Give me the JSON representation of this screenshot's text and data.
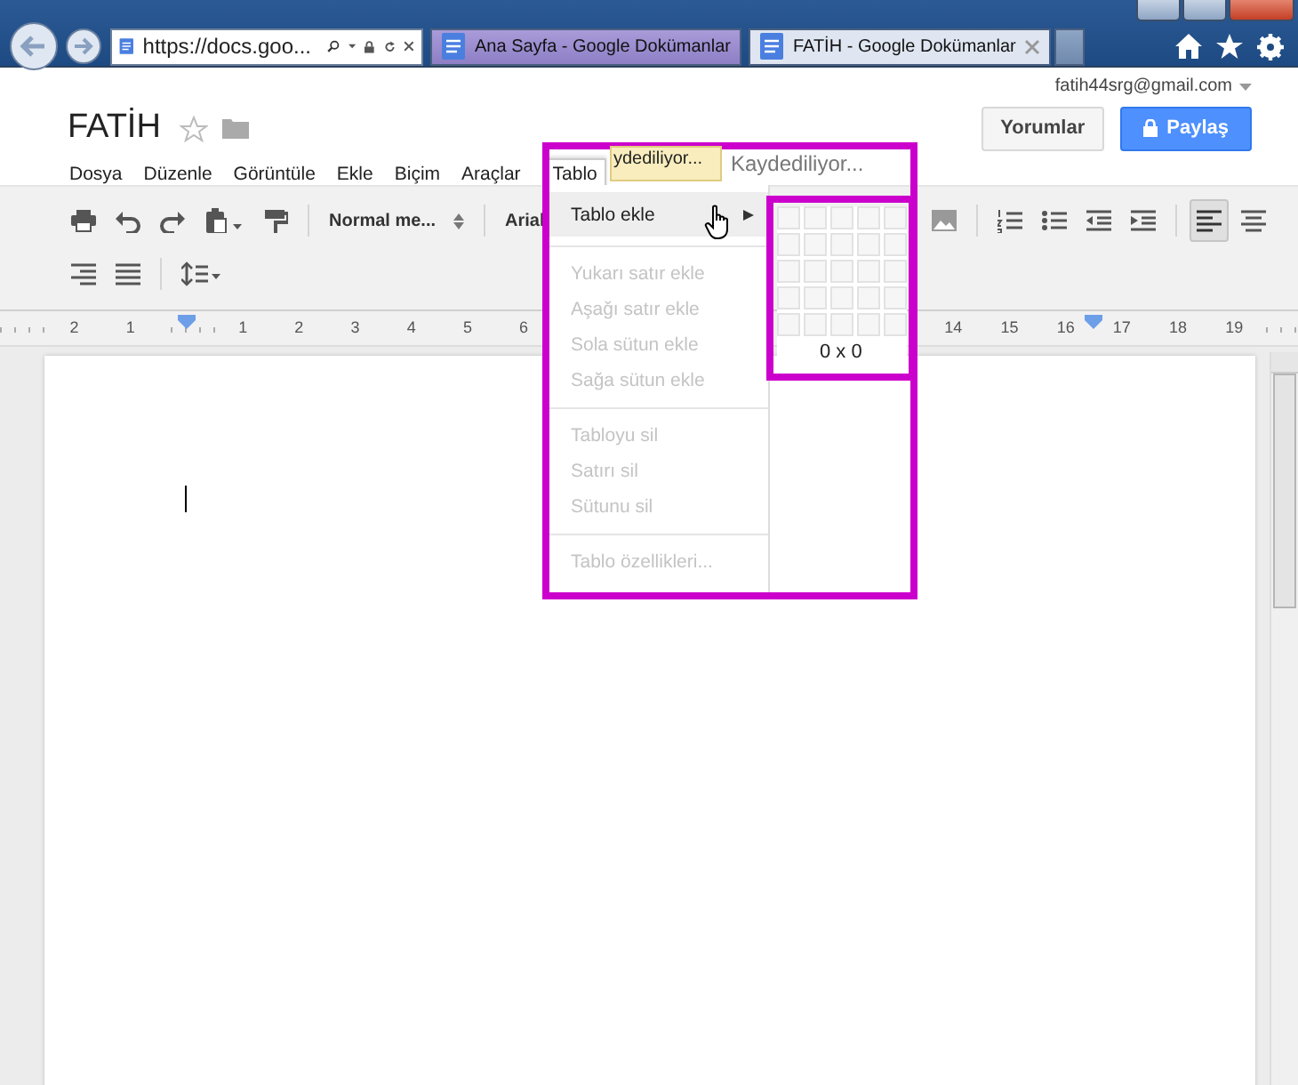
{
  "browser": {
    "address": "https://docs.goo...",
    "tabs": [
      {
        "title": "Ana Sayfa - Google Dokümanlar",
        "selected": false
      },
      {
        "title": "FATİH - Google Dokümanlar",
        "selected": true
      }
    ]
  },
  "document": {
    "title": "FATİH",
    "account": "fatih44srg@gmail.com",
    "buttons": [
      {
        "label": "Yorumlar",
        "kind": "plain"
      },
      {
        "label": "Paylaş",
        "kind": "share"
      }
    ],
    "menus": [
      {
        "label": "Dosya",
        "open": false
      },
      {
        "label": "Düzenle",
        "open": false
      },
      {
        "label": "Görüntüle",
        "open": false
      },
      {
        "label": "Ekle",
        "open": false
      },
      {
        "label": "Biçim",
        "open": false
      },
      {
        "label": "Araçlar",
        "open": false
      },
      {
        "label": "Tablo",
        "open": true
      }
    ],
    "save_tooltip": "ydediliyor...",
    "save_status": "Kaydediliyor..."
  },
  "toolbar": {
    "row_1_left": [
      {
        "kind": "print",
        "pressed": false
      },
      {
        "kind": "undo",
        "pressed": false
      },
      {
        "kind": "redo",
        "pressed": false
      },
      {
        "kind": "paste",
        "pressed": false
      },
      {
        "kind": "paint-format",
        "pressed": false
      },
      {
        "kind": "select",
        "label": "Normal me...",
        "pressed": false
      },
      {
        "kind": "font",
        "label": "Arial",
        "pressed": false
      }
    ],
    "row_1_right": [
      {
        "kind": "image",
        "pressed": false
      },
      {
        "kind": "numbered-list",
        "pressed": false
      },
      {
        "kind": "bulleted-list",
        "pressed": false
      },
      {
        "kind": "outdent",
        "pressed": false
      },
      {
        "kind": "indent",
        "pressed": false
      },
      {
        "kind": "align-left",
        "pressed": true
      },
      {
        "kind": "align-center",
        "pressed": false
      }
    ],
    "row_2": [
      {
        "kind": "align-right",
        "pressed": false
      },
      {
        "kind": "justify",
        "pressed": false
      },
      {
        "kind": "line-spacing",
        "pressed": false
      }
    ]
  },
  "ruler": {
    "left": [
      {
        "kind": "number",
        "label": "2"
      },
      {
        "kind": "number",
        "label": "1"
      },
      {
        "kind": "marker"
      },
      {
        "kind": "number",
        "label": "1"
      },
      {
        "kind": "number",
        "label": "2"
      },
      {
        "kind": "number",
        "label": "3"
      },
      {
        "kind": "number",
        "label": "4"
      },
      {
        "kind": "number",
        "label": "5"
      },
      {
        "kind": "number",
        "label": "6"
      }
    ],
    "right": [
      {
        "kind": "number",
        "label": "14"
      },
      {
        "kind": "number",
        "label": "15"
      },
      {
        "kind": "number",
        "label": "16"
      },
      {
        "kind": "marker"
      },
      {
        "kind": "number",
        "label": "17"
      },
      {
        "kind": "number",
        "label": "18"
      },
      {
        "kind": "number",
        "label": "19"
      }
    ]
  },
  "table_menu": {
    "items": [
      {
        "kind": "item",
        "label": "Tablo ekle",
        "disabled": false,
        "highlighted": true,
        "submenu": true
      },
      {
        "kind": "separator"
      },
      {
        "kind": "item",
        "label": "Yukarı satır ekle",
        "disabled": true,
        "highlighted": false,
        "submenu": false
      },
      {
        "kind": "item",
        "label": "Aşağı satır ekle",
        "disabled": true,
        "highlighted": false,
        "submenu": false
      },
      {
        "kind": "item",
        "label": "Sola sütun ekle",
        "disabled": true,
        "highlighted": false,
        "submenu": false
      },
      {
        "kind": "item",
        "label": "Sağa sütun ekle",
        "disabled": true,
        "highlighted": false,
        "submenu": false
      },
      {
        "kind": "separator"
      },
      {
        "kind": "item",
        "label": "Tabloyu sil",
        "disabled": true,
        "highlighted": false,
        "submenu": false
      },
      {
        "kind": "item",
        "label": "Satırı sil",
        "disabled": true,
        "highlighted": false,
        "submenu": false
      },
      {
        "kind": "item",
        "label": "Sütunu sil",
        "disabled": true,
        "highlighted": false,
        "submenu": false
      },
      {
        "kind": "separator"
      },
      {
        "kind": "item",
        "label": "Tablo özellikleri...",
        "disabled": true,
        "highlighted": false,
        "submenu": false
      }
    ],
    "grid_size": "0 x 0"
  }
}
